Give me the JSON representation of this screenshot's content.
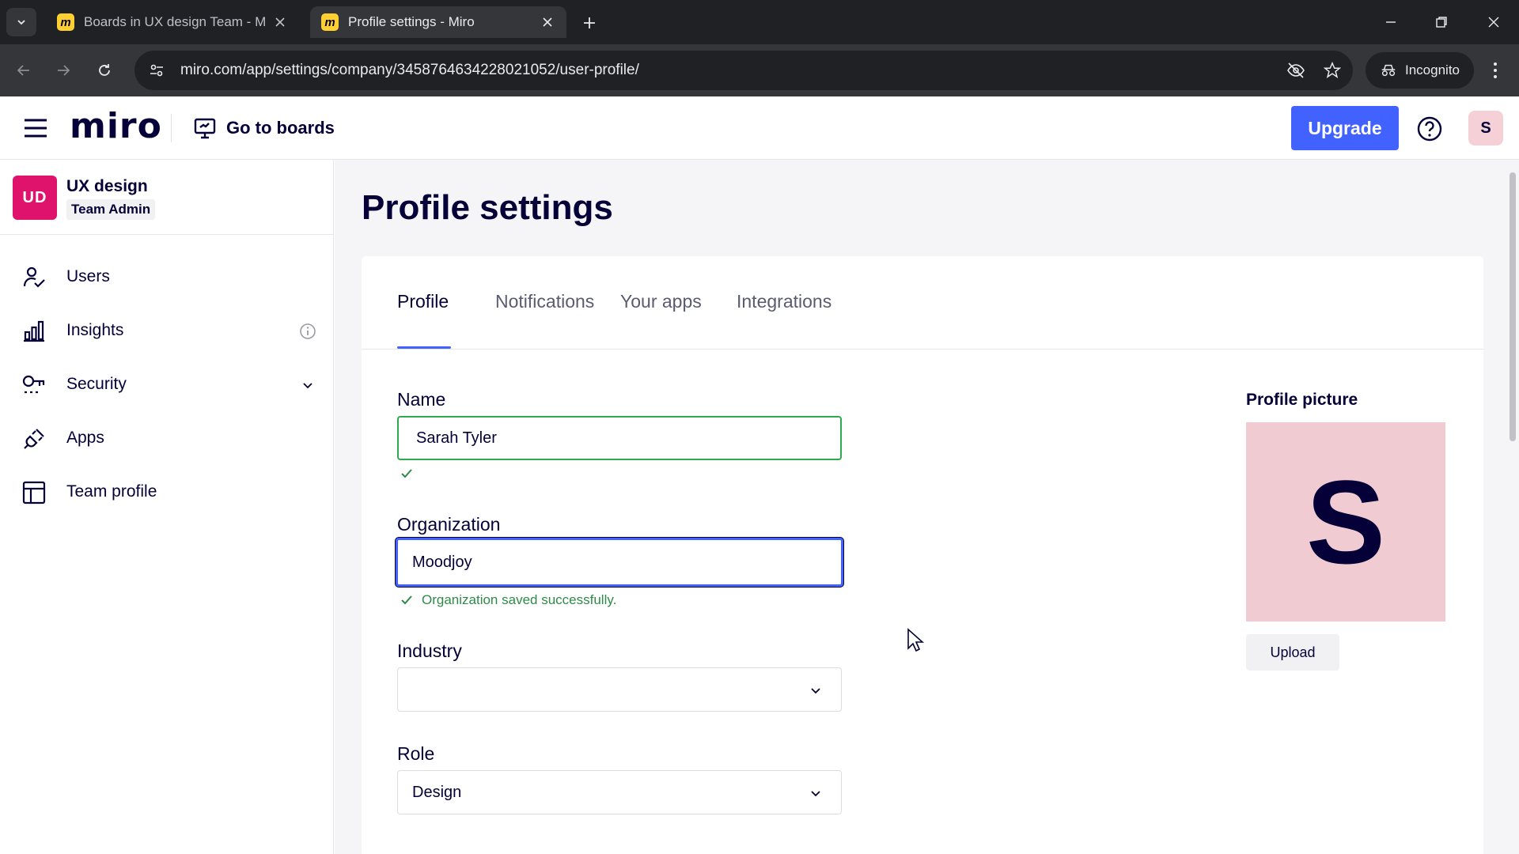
{
  "browser": {
    "tabs": [
      {
        "title": "Boards in UX design Team - Mi",
        "active": false
      },
      {
        "title": "Profile settings - Miro",
        "active": true
      }
    ],
    "url": "miro.com/app/settings/company/3458764634228021052/user-profile/",
    "incognito_label": "Incognito"
  },
  "header": {
    "logo": "miro",
    "go_to_boards": "Go to boards",
    "upgrade_label": "Upgrade",
    "avatar_initial": "S"
  },
  "sidebar": {
    "team": {
      "initials": "UD",
      "name": "UX design",
      "role": "Team Admin"
    },
    "items": [
      {
        "label": "Users",
        "icon": "user-check-icon"
      },
      {
        "label": "Insights",
        "icon": "bar-chart-icon"
      },
      {
        "label": "Security",
        "icon": "key-icon"
      },
      {
        "label": "Apps",
        "icon": "plug-icon"
      },
      {
        "label": "Team profile",
        "icon": "layout-icon"
      }
    ]
  },
  "main": {
    "title": "Profile settings",
    "tabs": [
      {
        "label": "Profile",
        "active": true
      },
      {
        "label": "Notifications",
        "active": false
      },
      {
        "label": "Your apps",
        "active": false
      },
      {
        "label": "Integrations",
        "active": false
      }
    ],
    "form": {
      "name_label": "Name",
      "name_value": "Sarah Tyler",
      "org_label": "Organization",
      "org_value": "Moodjoy",
      "org_success": "Organization saved successfully.",
      "industry_label": "Industry",
      "industry_value": "",
      "role_label": "Role",
      "role_value": "Design"
    },
    "profile_picture": {
      "label": "Profile picture",
      "initial": "S",
      "upload_label": "Upload"
    }
  },
  "colors": {
    "accent": "#4262ff",
    "success": "#2fa84f",
    "team_badge": "#e0136c",
    "avatar_bg": "#f0ccd2"
  }
}
